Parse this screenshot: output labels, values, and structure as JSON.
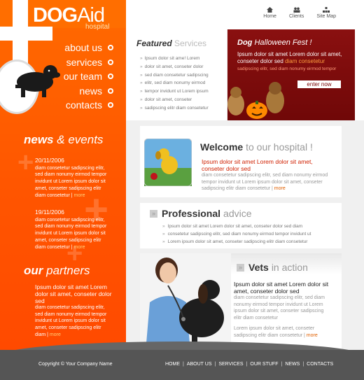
{
  "logo": {
    "name_bold": "DOG",
    "name_light": "Aid",
    "subtitle": "hospital"
  },
  "nav": {
    "items": [
      "about us",
      "services",
      "our team",
      "news",
      "contacts"
    ]
  },
  "topnav": {
    "items": [
      "Home",
      "Clients",
      "Site Map"
    ]
  },
  "featured": {
    "title_bold": "Featured",
    "title_light": "Services",
    "items": [
      "Ipsum dolor sit ame! Lorem",
      "dolor sit amet, conseter dolor",
      "sed diam consetetur sadipscing",
      "elitr, sed diam nonumy eirmod",
      "tempor invidunt ut Lorem ipsum",
      "dolor sit amet, conseter",
      "sadipscing elitr diam consetetur"
    ]
  },
  "halloween": {
    "title_bold": "Dog",
    "title_light": "Halloween Fest !",
    "text": "Ipsum dolor sit amet Lorem dolor sit amet, conseter dolor sed",
    "highlight": "diam consetetur",
    "sub": "sadipscing elitr, sed diam nonumy eirmod tempor",
    "button": "enter now"
  },
  "news": {
    "title_bold": "news",
    "title_light": "& events",
    "items": [
      {
        "date": "20/11/2006",
        "text": "diam consetetur sadipscing elitr, sed diam nonumy eirmod tempor invidunt ut Lorem ipsum dolor sit amet, conseter sadipscing elitr diam consetetur",
        "more": "more"
      },
      {
        "date": "19/11/2006",
        "text": "diam consetetur sadipscing elitr, sed diam nonumy eirmod tempor invidunt ut Lorem ipsum dolor sit amet, conseter sadipscing elitr diam consetetur",
        "more": "more"
      }
    ]
  },
  "partners": {
    "title_bold": "our",
    "title_light": "partners",
    "lead": "Ipsum dolor sit amet Lorem dolor sit amet, conseter dolor sed",
    "text": "diam consetetur sadipscing elitr, sed diam nonumy eirmod tempor invidunt ut Lorem ipsum dolor sit amet, conseter sadipscing elitr diam",
    "more": "more"
  },
  "welcome": {
    "title_bold": "Welcome",
    "title_light": "to our hospital !",
    "lead": "Ipsum dolor sit amet Lorem dolor sit amet, conseter dolor sed",
    "text": "diam consetetur sadipscing elitr, sed diam nonumy eirmod tempor invidunt ut Lorem ipsum dolor sit amet, conseter sadipscing elitr diam consetetur",
    "more": "more"
  },
  "professional": {
    "title_bold": "Professional",
    "title_light": "advice",
    "items": [
      "Ipsum dolor sit amet Lorem dolor sit amet, conseter dolor sed diam",
      "consetetur sadipscing elitr, sed diam nonumy eirmod tempor invidunt ut",
      "Lorem ipsum dolor sit amet, conseter sadipscing elitr diam consetetur"
    ]
  },
  "vets": {
    "title_bold": "Vets",
    "title_light": "in action",
    "lead": "Ipsum dolor sit amet Lorem dolor sit amet, conseter dolor sed",
    "text": "diam consetetur sadipscing elitr, sed diam nonumy eirmod tempor invidunt ut Lorem ipsum dolor sit amet, conseter sadipscing elitr diam consetetur",
    "text2": "Lorem ipsum dolor sit amet, conseter sadipscing elitr diam consetetur",
    "more": "more"
  },
  "footer": {
    "copyright": "Copyright © Your Company Name",
    "links": [
      "HOME",
      "ABOUT US",
      "SERVICES",
      "OUR STUFF",
      "NEWS",
      "CONTACTS"
    ]
  },
  "colors": {
    "orange": "#ff5a00",
    "dark_red": "#7a0c0c",
    "footer": "#555555"
  }
}
